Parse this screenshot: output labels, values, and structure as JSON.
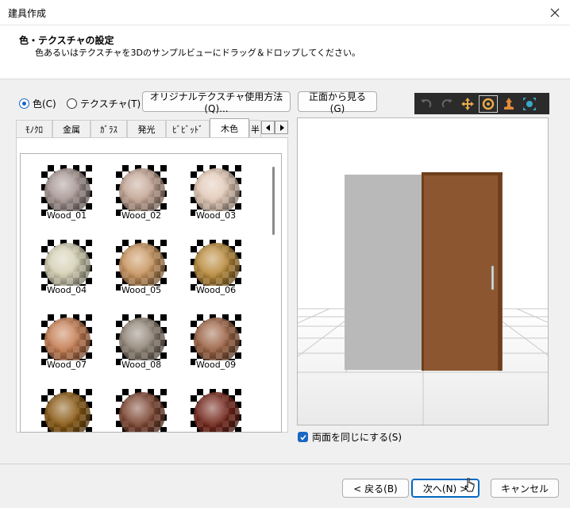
{
  "window": {
    "title": "建具作成"
  },
  "header": {
    "title": "色・テクスチャの設定",
    "subtitle": "色あるいはテクスチャを3Dのサンプルビューにドラッグ＆ドロップしてください。"
  },
  "mode": {
    "options": [
      {
        "label": "色(C)",
        "selected": true
      },
      {
        "label": "テクスチャ(T)",
        "selected": false
      }
    ]
  },
  "buttons": {
    "original_texture": "オリジナルテクスチャ使用方法(Q)...",
    "view_front": "正面から見る(G)",
    "back": "< 戻る(B)",
    "next": "次へ(N) >",
    "cancel": "キャンセル"
  },
  "toolbar3d": {
    "tools": [
      {
        "icon": "undo-icon",
        "active": false
      },
      {
        "icon": "redo-icon",
        "active": false
      },
      {
        "icon": "move-icon",
        "active": false
      },
      {
        "icon": "rotate-icon",
        "active": true
      },
      {
        "icon": "zoom-icon",
        "active": false
      },
      {
        "icon": "fit-view-icon",
        "active": false
      }
    ]
  },
  "tabs": {
    "items": [
      {
        "label": "ﾓﾉｸﾛ",
        "active": false
      },
      {
        "label": "金属",
        "active": false
      },
      {
        "label": "ｶﾞﾗｽ",
        "active": false
      },
      {
        "label": "発光",
        "active": false
      },
      {
        "label": "ﾋﾞﾋﾞｯﾄﾞ",
        "active": false
      },
      {
        "label": "木色",
        "active": true
      },
      {
        "label": "半",
        "active": false
      }
    ]
  },
  "swatches": [
    {
      "label": "Wood_01",
      "color": "#a69692"
    },
    {
      "label": "Wood_02",
      "color": "#c2a493"
    },
    {
      "label": "Wood_03",
      "color": "#e2c9b6"
    },
    {
      "label": "Wood_04",
      "color": "#d4d0b4"
    },
    {
      "label": "Wood_05",
      "color": "#c8945e"
    },
    {
      "label": "Wood_06",
      "color": "#b98a3c"
    },
    {
      "label": "Wood_07",
      "color": "#c57d52"
    },
    {
      "label": "Wood_08",
      "color": "#918476"
    },
    {
      "label": "Wood_09",
      "color": "#9c6445"
    },
    {
      "label": "",
      "color": "#8a5a14"
    },
    {
      "label": "",
      "color": "#7d4632"
    },
    {
      "label": "",
      "color": "#74281c"
    }
  ],
  "preview": {
    "wall_color": "#b9b9b9",
    "door_color": "#8c5730",
    "door_edge_color": "#6e3f1c"
  },
  "both_sides": {
    "label": "両面を同じにする(S)",
    "checked": true
  }
}
